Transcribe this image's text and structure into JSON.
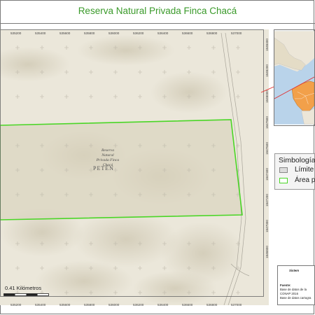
{
  "title": "Reserva Natural Privada Finca Chacá",
  "map": {
    "x_ticks": [
      "535200",
      "535400",
      "535600",
      "535800",
      "536000",
      "536200",
      "536400",
      "536600",
      "536800",
      "537000"
    ],
    "y_ticks": [
      "1848400",
      "1848200",
      "1848000",
      "1847800",
      "1847600",
      "1847400",
      "1847200",
      "1847000",
      "1846800"
    ],
    "reserve_label": [
      "Reserva",
      "Natural",
      "Privada Finca",
      "Chacá"
    ],
    "region_label": "PETÉN",
    "scale_label": "0.41 Kilómetros",
    "colors": {
      "boundary": "#4ad626",
      "land": "#e8e4d6",
      "reserve_fill": "#d9d2bd",
      "inset_country": "#f2a04a",
      "inset_water": "#b9d3ea"
    }
  },
  "legend": {
    "title": "Simbología",
    "items": [
      {
        "label": "Límite",
        "swatch": "#dcdcdc",
        "border": "#888888"
      },
      {
        "label": "Área pr",
        "swatch": "#ffffff",
        "border": "#4ad626"
      }
    ]
  },
  "info": {
    "heading": "Sistem",
    "source_label": "Fuente:",
    "lines": [
      "Base de datos de la",
      "CONAP 2016",
      "Base de datos cartogra"
    ]
  }
}
